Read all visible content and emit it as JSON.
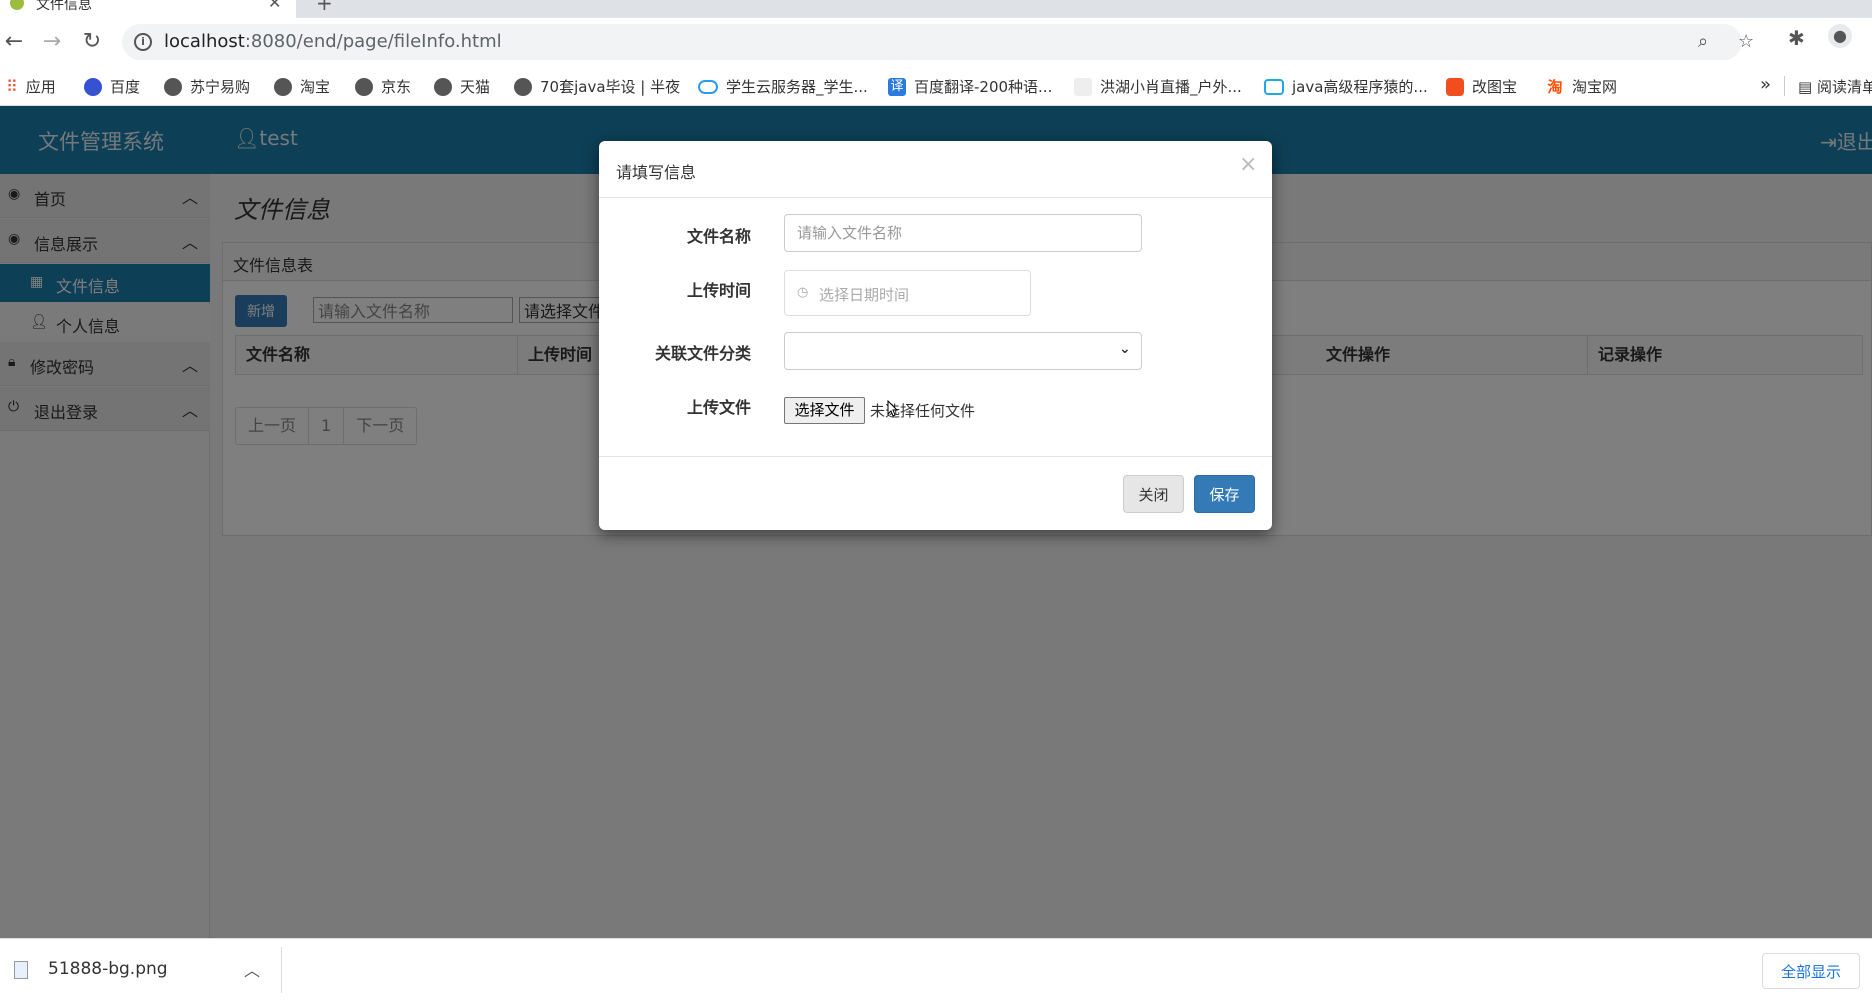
{
  "browser": {
    "tab_title": "文件信息",
    "url_host": "localhost",
    "url_rest": ":8080/end/page/fileInfo.html",
    "bookmarks": [
      "应用",
      "百度",
      "苏宁易购",
      "淘宝",
      "京东",
      "天猫",
      "70套java毕设 | 半夜",
      "学生云服务器_学生...",
      "百度翻译-200种语...",
      "洪湖小肖直播_户外...",
      "java高级程序猿的...",
      "改图宝",
      "淘宝网"
    ],
    "bookmarks_more": "»",
    "reading_list": "阅读清单"
  },
  "header": {
    "brand": "文件管理系统",
    "user": "test",
    "logout": "退出"
  },
  "sidebar": {
    "home": "首页",
    "info_display": "信息展示",
    "file_info": "文件信息",
    "personal_info": "个人信息",
    "change_password": "修改密码",
    "logout": "退出登录"
  },
  "content": {
    "page_title": "文件信息",
    "panel_title": "文件信息表",
    "add_button": "新增",
    "search_placeholder": "请输入文件名称",
    "category_placeholder": "请选择文件",
    "columns": [
      "文件名称",
      "上传时间",
      "文件操作",
      "记录操作"
    ],
    "pager": [
      "上一页",
      "1",
      "下一页"
    ]
  },
  "modal": {
    "title": "请填写信息",
    "close_x": "×",
    "file_name_label": "文件名称",
    "file_name_placeholder": "请输入文件名称",
    "upload_time_label": "上传时间",
    "upload_time_placeholder": "选择日期时间",
    "category_label": "关联文件分类",
    "category_value": "",
    "upload_file_label": "上传文件",
    "choose_file_button": "选择文件",
    "no_file_text": "未选择任何文件",
    "close_button": "关闭",
    "save_button": "保存"
  },
  "downloads": {
    "file_name": "51888-bg.png",
    "show_all": "全部显示"
  },
  "colors": {
    "header": "#1b7fad",
    "primary": "#337ab7"
  }
}
